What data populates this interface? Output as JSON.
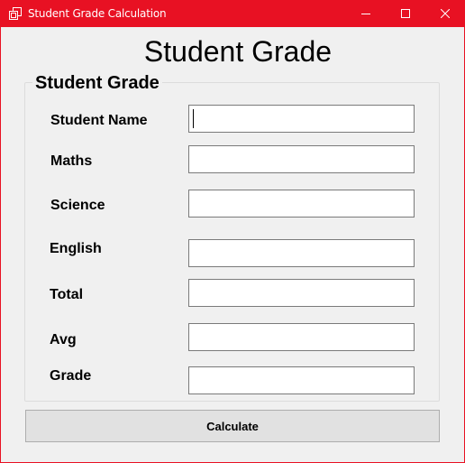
{
  "window": {
    "title": "Student Grade Calculation",
    "accent_color": "#e81123",
    "controls": {
      "minimize_icon": "minimize-icon",
      "maximize_icon": "maximize-icon",
      "close_icon": "close-icon"
    }
  },
  "form": {
    "heading": "Student Grade",
    "group_title": "Student Grade",
    "fields": [
      {
        "label": "Student Name",
        "value": ""
      },
      {
        "label": "Maths",
        "value": ""
      },
      {
        "label": "Science",
        "value": ""
      },
      {
        "label": "English",
        "value": ""
      },
      {
        "label": "Total",
        "value": ""
      },
      {
        "label": "Avg",
        "value": ""
      },
      {
        "label": "Grade",
        "value": ""
      }
    ],
    "calculate_label": "Calculate"
  }
}
